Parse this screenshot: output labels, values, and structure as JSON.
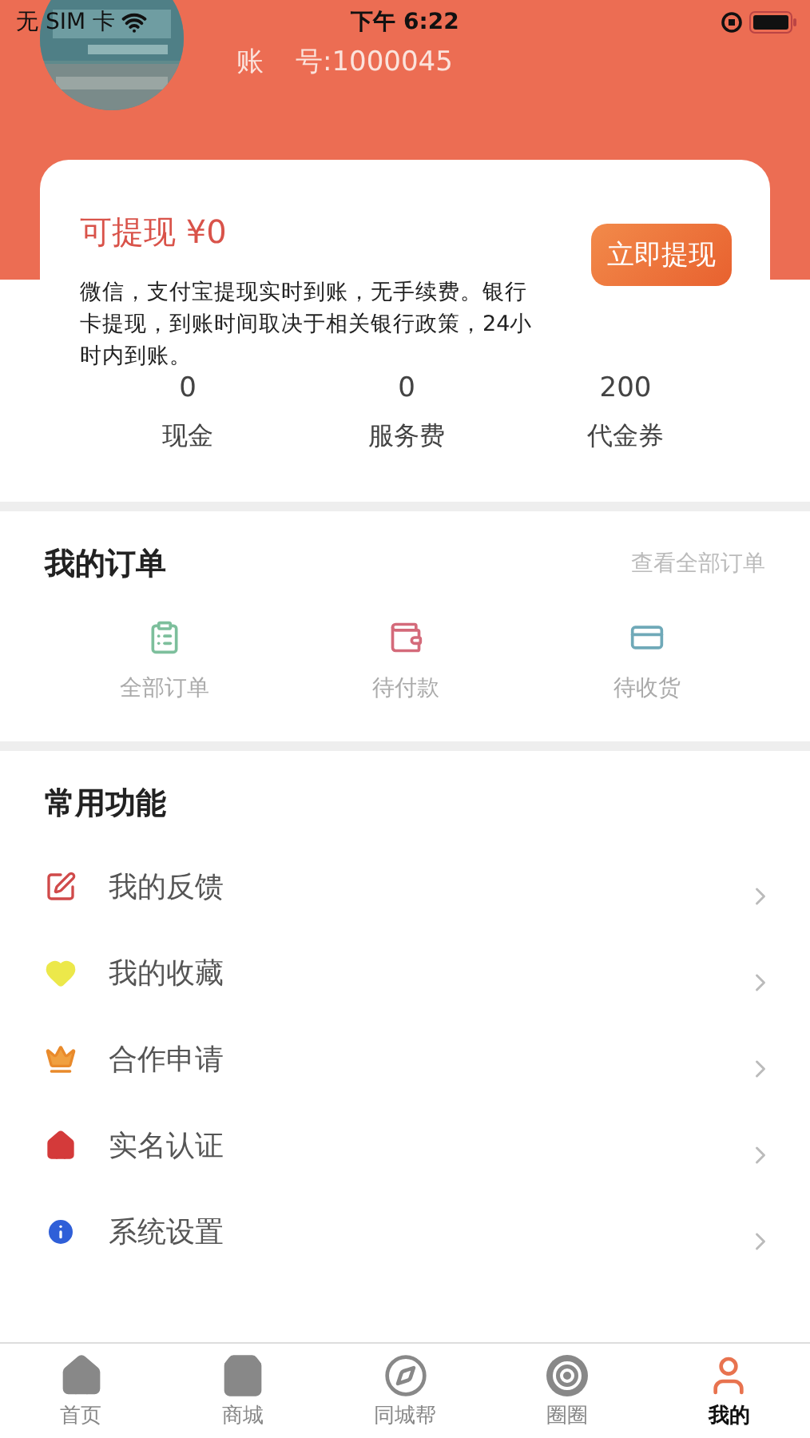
{
  "status_bar": {
    "carrier": "无 SIM 卡",
    "time": "下午 6:22"
  },
  "profile": {
    "account_label": "账",
    "account_value": "号:1000045"
  },
  "balance": {
    "title": "可提现 ¥0",
    "withdraw_button": "立即提现",
    "note": "微信，支付宝提现实时到账，无手续费。银行卡提现，到账时间取决于相关银行政策，24小时内到账。",
    "stats": [
      {
        "value": "0",
        "label": "现金"
      },
      {
        "value": "0",
        "label": "服务费"
      },
      {
        "value": "200",
        "label": "代金券"
      }
    ]
  },
  "orders": {
    "title": "我的订单",
    "view_all": "查看全部订单",
    "items": [
      {
        "label": "全部订单",
        "kind": "clipboard"
      },
      {
        "label": "待付款",
        "kind": "wallet"
      },
      {
        "label": "待收货",
        "kind": "card"
      }
    ]
  },
  "functions": {
    "title": "常用功能",
    "items": [
      {
        "label": "我的反馈",
        "kind": "feedback"
      },
      {
        "label": "我的收藏",
        "kind": "favorite"
      },
      {
        "label": "合作申请",
        "kind": "crown"
      },
      {
        "label": "实名认证",
        "kind": "house"
      },
      {
        "label": "系统设置",
        "kind": "info"
      }
    ]
  },
  "tab_bar": [
    {
      "label": "首页",
      "kind": "home",
      "selected": false
    },
    {
      "label": "商城",
      "kind": "bag",
      "selected": false
    },
    {
      "label": "同城帮",
      "kind": "compass",
      "selected": false
    },
    {
      "label": "圈圈",
      "kind": "swirl",
      "selected": false
    },
    {
      "label": "我的",
      "kind": "user",
      "selected": true
    }
  ]
}
